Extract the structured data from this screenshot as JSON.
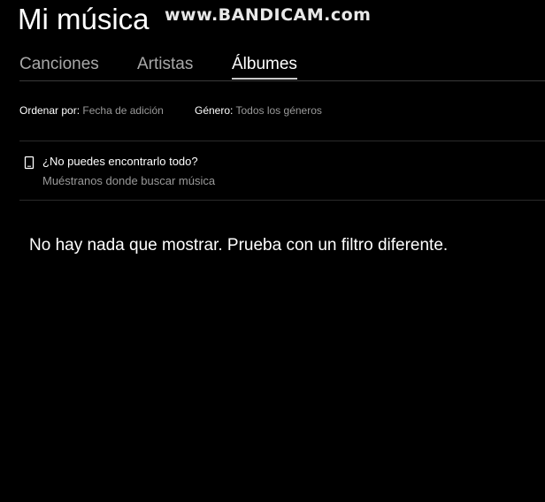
{
  "header": {
    "title": "Mi música",
    "watermark": "www.BANDICAM.com"
  },
  "tabs": [
    {
      "label": "Canciones",
      "selected": false
    },
    {
      "label": "Artistas",
      "selected": false
    },
    {
      "label": "Álbumes",
      "selected": true
    }
  ],
  "filters": {
    "sort_label": "Ordenar por:",
    "sort_value": "Fecha de adición",
    "genre_label": "Género:",
    "genre_value": "Todos los géneros"
  },
  "hint": {
    "icon": "phone-icon",
    "title": "¿No puedes encontrarlo todo?",
    "subtitle": "Muéstranos donde buscar música"
  },
  "empty_state": {
    "message": "No hay nada que mostrar. Prueba con un filtro diferente."
  },
  "colors": {
    "background": "#000000",
    "text_primary": "#ffffff",
    "text_secondary": "#9a9a9a",
    "tab_inactive": "#a8a8a8"
  }
}
